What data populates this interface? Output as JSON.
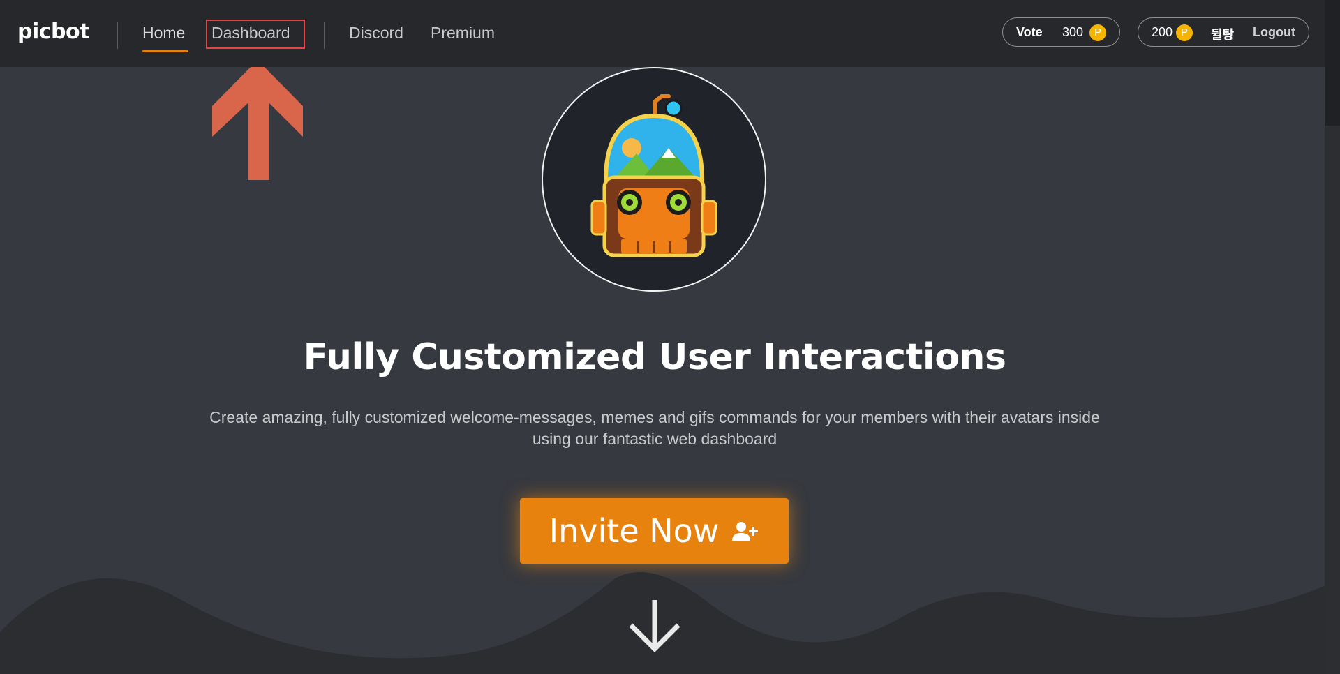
{
  "brand": {
    "name": "picbot"
  },
  "nav": {
    "home": "Home",
    "dashboard": "Dashboard",
    "discord": "Discord",
    "premium": "Premium"
  },
  "vote": {
    "label": "Vote",
    "points": "300",
    "coin_symbol": "P"
  },
  "account": {
    "points": "200",
    "coin_symbol": "P",
    "username": "뒬탕",
    "logout": "Logout"
  },
  "hero": {
    "title": "Fully Customized User Interactions",
    "subtitle": "Create amazing, fully customized welcome-messages, memes and gifs commands for your members with their avatars inside using our fantastic web dashboard",
    "cta_label": "Invite Now",
    "cta_icon": "user-plus-icon"
  },
  "annotation": {
    "icon": "arrow-up-icon",
    "color": "#d9654a"
  },
  "colors": {
    "accent": "#e8820f",
    "background": "#36393f",
    "navbar": "#26282b",
    "highlight": "#e04848",
    "coin": "#f4b400"
  }
}
